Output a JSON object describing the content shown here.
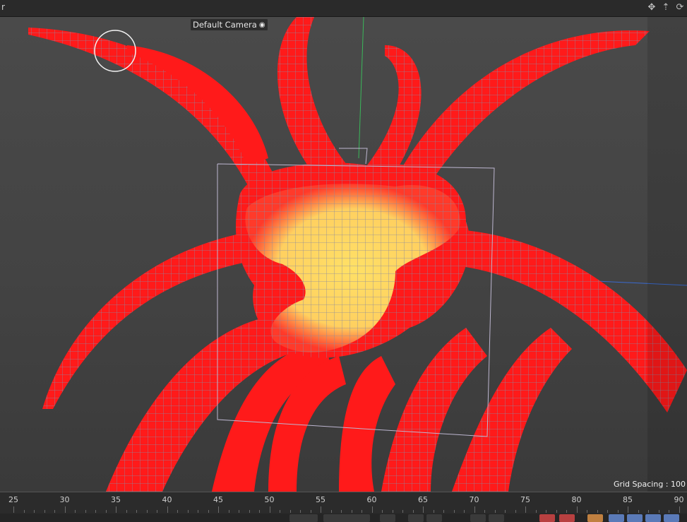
{
  "window": {
    "menu_label": "r"
  },
  "viewport": {
    "camera_label": "Default Camera",
    "grid_spacing_label": "Grid Spacing : 100"
  },
  "timeline": {
    "ticks": [
      "25",
      "30",
      "35",
      "40",
      "45",
      "50",
      "55",
      "60",
      "65",
      "70",
      "75",
      "80",
      "85",
      "90"
    ]
  },
  "colors": {
    "mesh_red": "#ff1a1a",
    "mesh_yellow": "#ffe066",
    "background": "#444444"
  },
  "icons": [
    "move-view-icon",
    "zoom-view-icon",
    "rotate-view-icon",
    "camera-icon"
  ]
}
